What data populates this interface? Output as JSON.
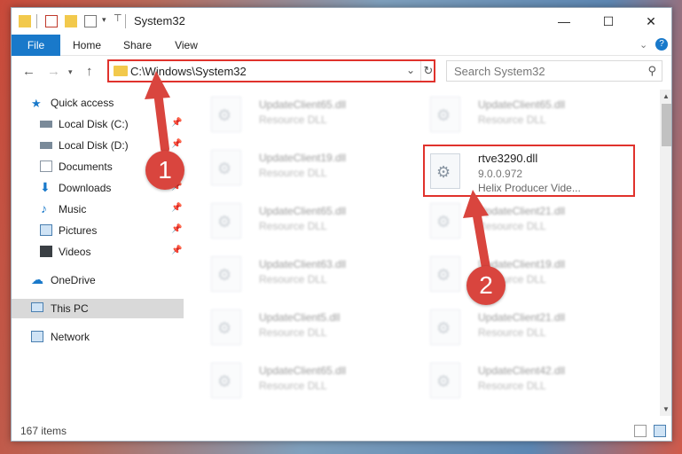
{
  "window": {
    "title": "System32",
    "buttons": {
      "minimize": "—",
      "maximize": "☐",
      "close": "✕"
    }
  },
  "ribbon": {
    "tabs": [
      {
        "label": "File"
      },
      {
        "label": "Home"
      },
      {
        "label": "Share"
      },
      {
        "label": "View"
      }
    ]
  },
  "nav": {
    "address": "C:\\Windows\\System32",
    "search_placeholder": "Search System32"
  },
  "sidebar": {
    "items": [
      {
        "label": "Quick access"
      },
      {
        "label": "Local Disk (C:)"
      },
      {
        "label": "Local Disk (D:)"
      },
      {
        "label": "Documents"
      },
      {
        "label": "Downloads"
      },
      {
        "label": "Music"
      },
      {
        "label": "Pictures"
      },
      {
        "label": "Videos"
      },
      {
        "label": "OneDrive"
      },
      {
        "label": "This PC"
      },
      {
        "label": "Network"
      }
    ]
  },
  "files": {
    "left": [
      {
        "name": "UpdateClient65.dll",
        "desc": "Resource DLL"
      },
      {
        "name": "UpdateClient19.dll",
        "desc": "Resource DLL"
      },
      {
        "name": "UpdateClient65.dll",
        "desc": "Resource DLL"
      },
      {
        "name": "UpdateClient63.dll",
        "desc": "Resource DLL"
      },
      {
        "name": "UpdateClient5.dll",
        "desc": "Resource DLL"
      },
      {
        "name": "UpdateClient65.dll",
        "desc": "Resource DLL"
      }
    ],
    "right": [
      {
        "name": "UpdateClient65.dll",
        "desc": "Resource DLL"
      },
      {
        "name": "UpdateClient21.dll",
        "desc": "Resource DLL"
      },
      {
        "name": "UpdateClient19.dll",
        "desc": "Resource DLL"
      },
      {
        "name": "UpdateClient21.dll",
        "desc": "Resource DLL"
      },
      {
        "name": "UpdateClient42.dll",
        "desc": "Resource DLL"
      }
    ],
    "selected": {
      "name": "rtve3290.dll",
      "version": "9.0.0.972",
      "desc": "Helix Producer Vide..."
    }
  },
  "status": {
    "count": "167 items"
  },
  "annotations": {
    "marker1": "1",
    "marker2": "2"
  },
  "colors": {
    "accent": "#1979ca",
    "annotation": "#e0322c"
  }
}
